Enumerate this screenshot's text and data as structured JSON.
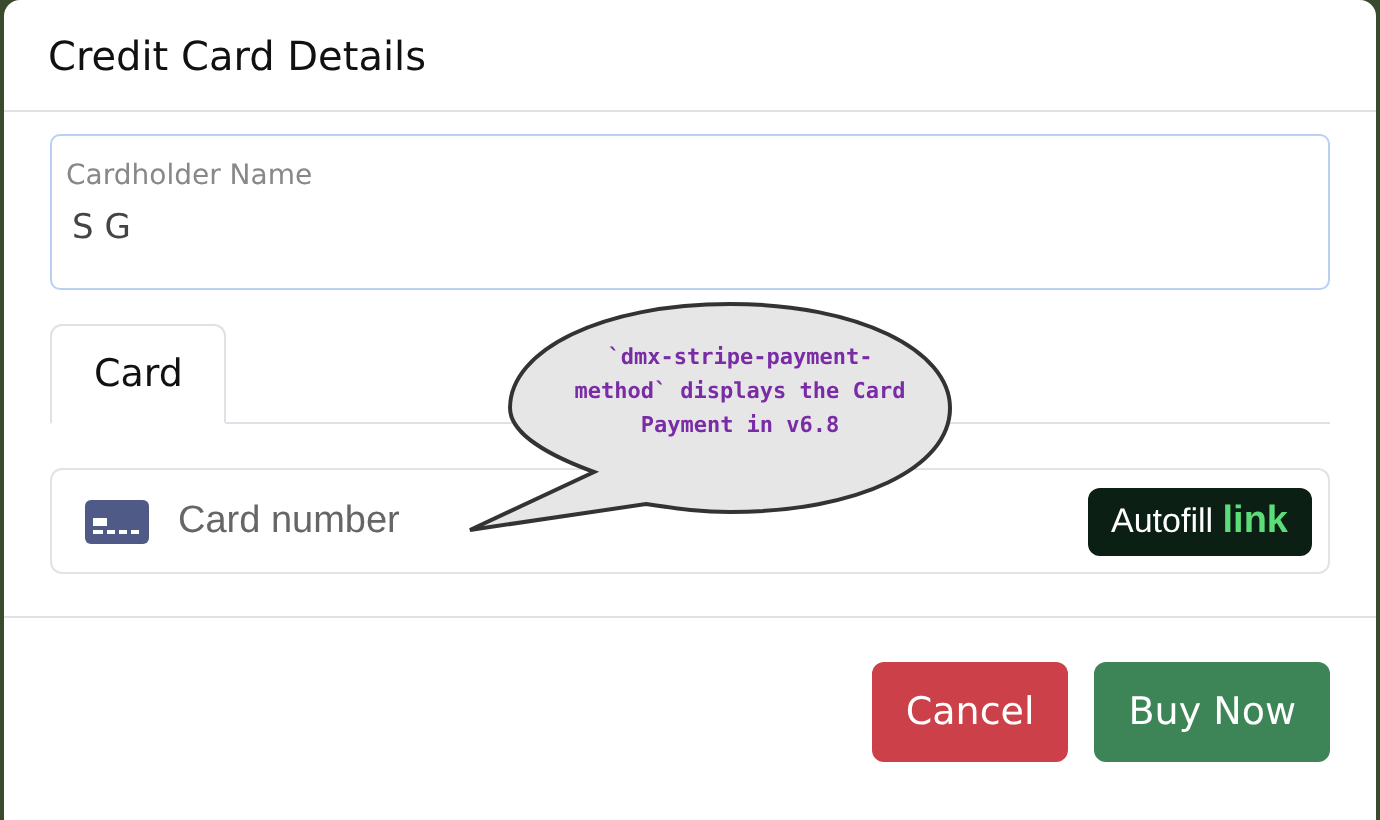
{
  "modal": {
    "title": "Credit Card Details"
  },
  "cardholder": {
    "label": "Cardholder Name",
    "value": "S G"
  },
  "tabs": [
    {
      "label": "Card",
      "selected": true
    }
  ],
  "card_number": {
    "placeholder": "Card number"
  },
  "autofill": {
    "label": "Autofill",
    "brand": "link"
  },
  "callout": {
    "text": "`dmx-stripe-payment-method` displays the Card Payment in v6.8"
  },
  "buttons": [
    {
      "label": "Cancel",
      "kind": "danger"
    },
    {
      "label": "Buy Now",
      "kind": "success"
    }
  ]
}
